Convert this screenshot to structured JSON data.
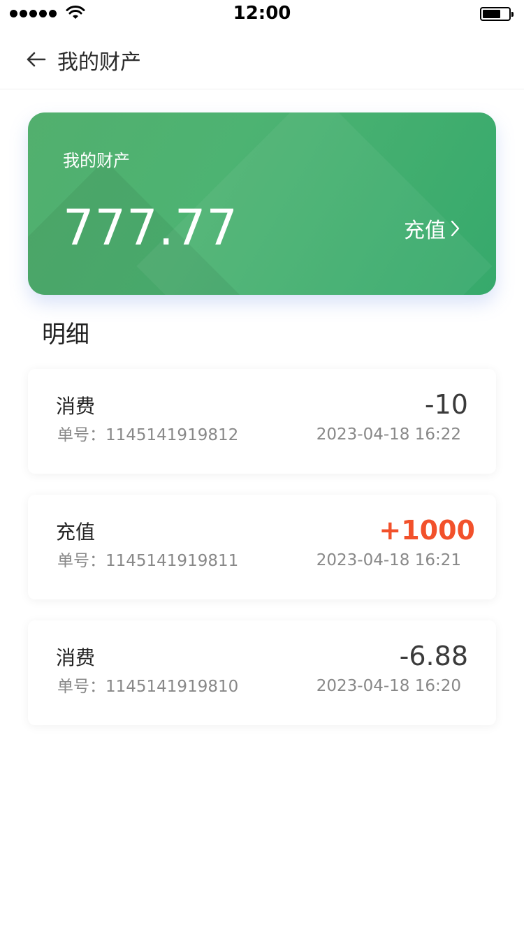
{
  "status_bar": {
    "time": "12:00"
  },
  "nav": {
    "title": "我的财产",
    "back_icon": "arrow-left-icon"
  },
  "asset_card": {
    "label": "我的财产",
    "amount": "777.77",
    "recharge_label": "充值",
    "recharge_icon": "chevron-right-icon",
    "gradient_start": "#52af6e",
    "gradient_end": "#36a96c"
  },
  "detail": {
    "title": "明细"
  },
  "transactions": [
    {
      "type": "消费",
      "order": "单号：1145141919812",
      "amount": "-10",
      "date": "2023-04-18 16:22",
      "kind": "expense"
    },
    {
      "type": "充值",
      "order": "单号：1145141919811",
      "amount": "+1000",
      "date": "2023-04-18 16:21",
      "kind": "income"
    },
    {
      "type": "消费",
      "order": "单号：1145141919810",
      "amount": "-6.88",
      "date": "2023-04-18 16:20",
      "kind": "expense"
    }
  ],
  "colors": {
    "income": "#f2512b",
    "expense": "#3a3a3a",
    "accent_green": "#4db372"
  }
}
